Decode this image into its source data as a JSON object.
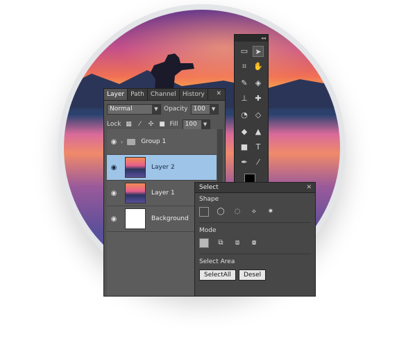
{
  "layers_panel": {
    "tabs": [
      "Layer",
      "Path",
      "Channel",
      "History"
    ],
    "blend_mode": "Normal",
    "opacity_label": "Opacity",
    "opacity_value": "100",
    "lock_label": "Lock",
    "fill_label": "Fill",
    "fill_value": "100",
    "layers": [
      {
        "name": "Group 1",
        "selected": false
      },
      {
        "name": "Layer 2",
        "selected": true
      },
      {
        "name": "Layer 1",
        "selected": false
      },
      {
        "name": "Background",
        "selected": false
      }
    ],
    "selection_color": "#9ec4e8"
  },
  "select_panel": {
    "title": "Select",
    "shape_label": "Shape",
    "mode_label": "Mode",
    "area_label": "Select Area",
    "select_all_button": "SelectAll",
    "deselect_button_partial": "Desel"
  },
  "toolbox": {
    "tools": [
      "marquee",
      "move",
      "crop",
      "hand",
      "brush",
      "eraser",
      "stamp",
      "healing",
      "lasso",
      "shape",
      "bucket",
      "gradient",
      "rectangle",
      "text",
      "pen",
      "eyedropper"
    ]
  }
}
